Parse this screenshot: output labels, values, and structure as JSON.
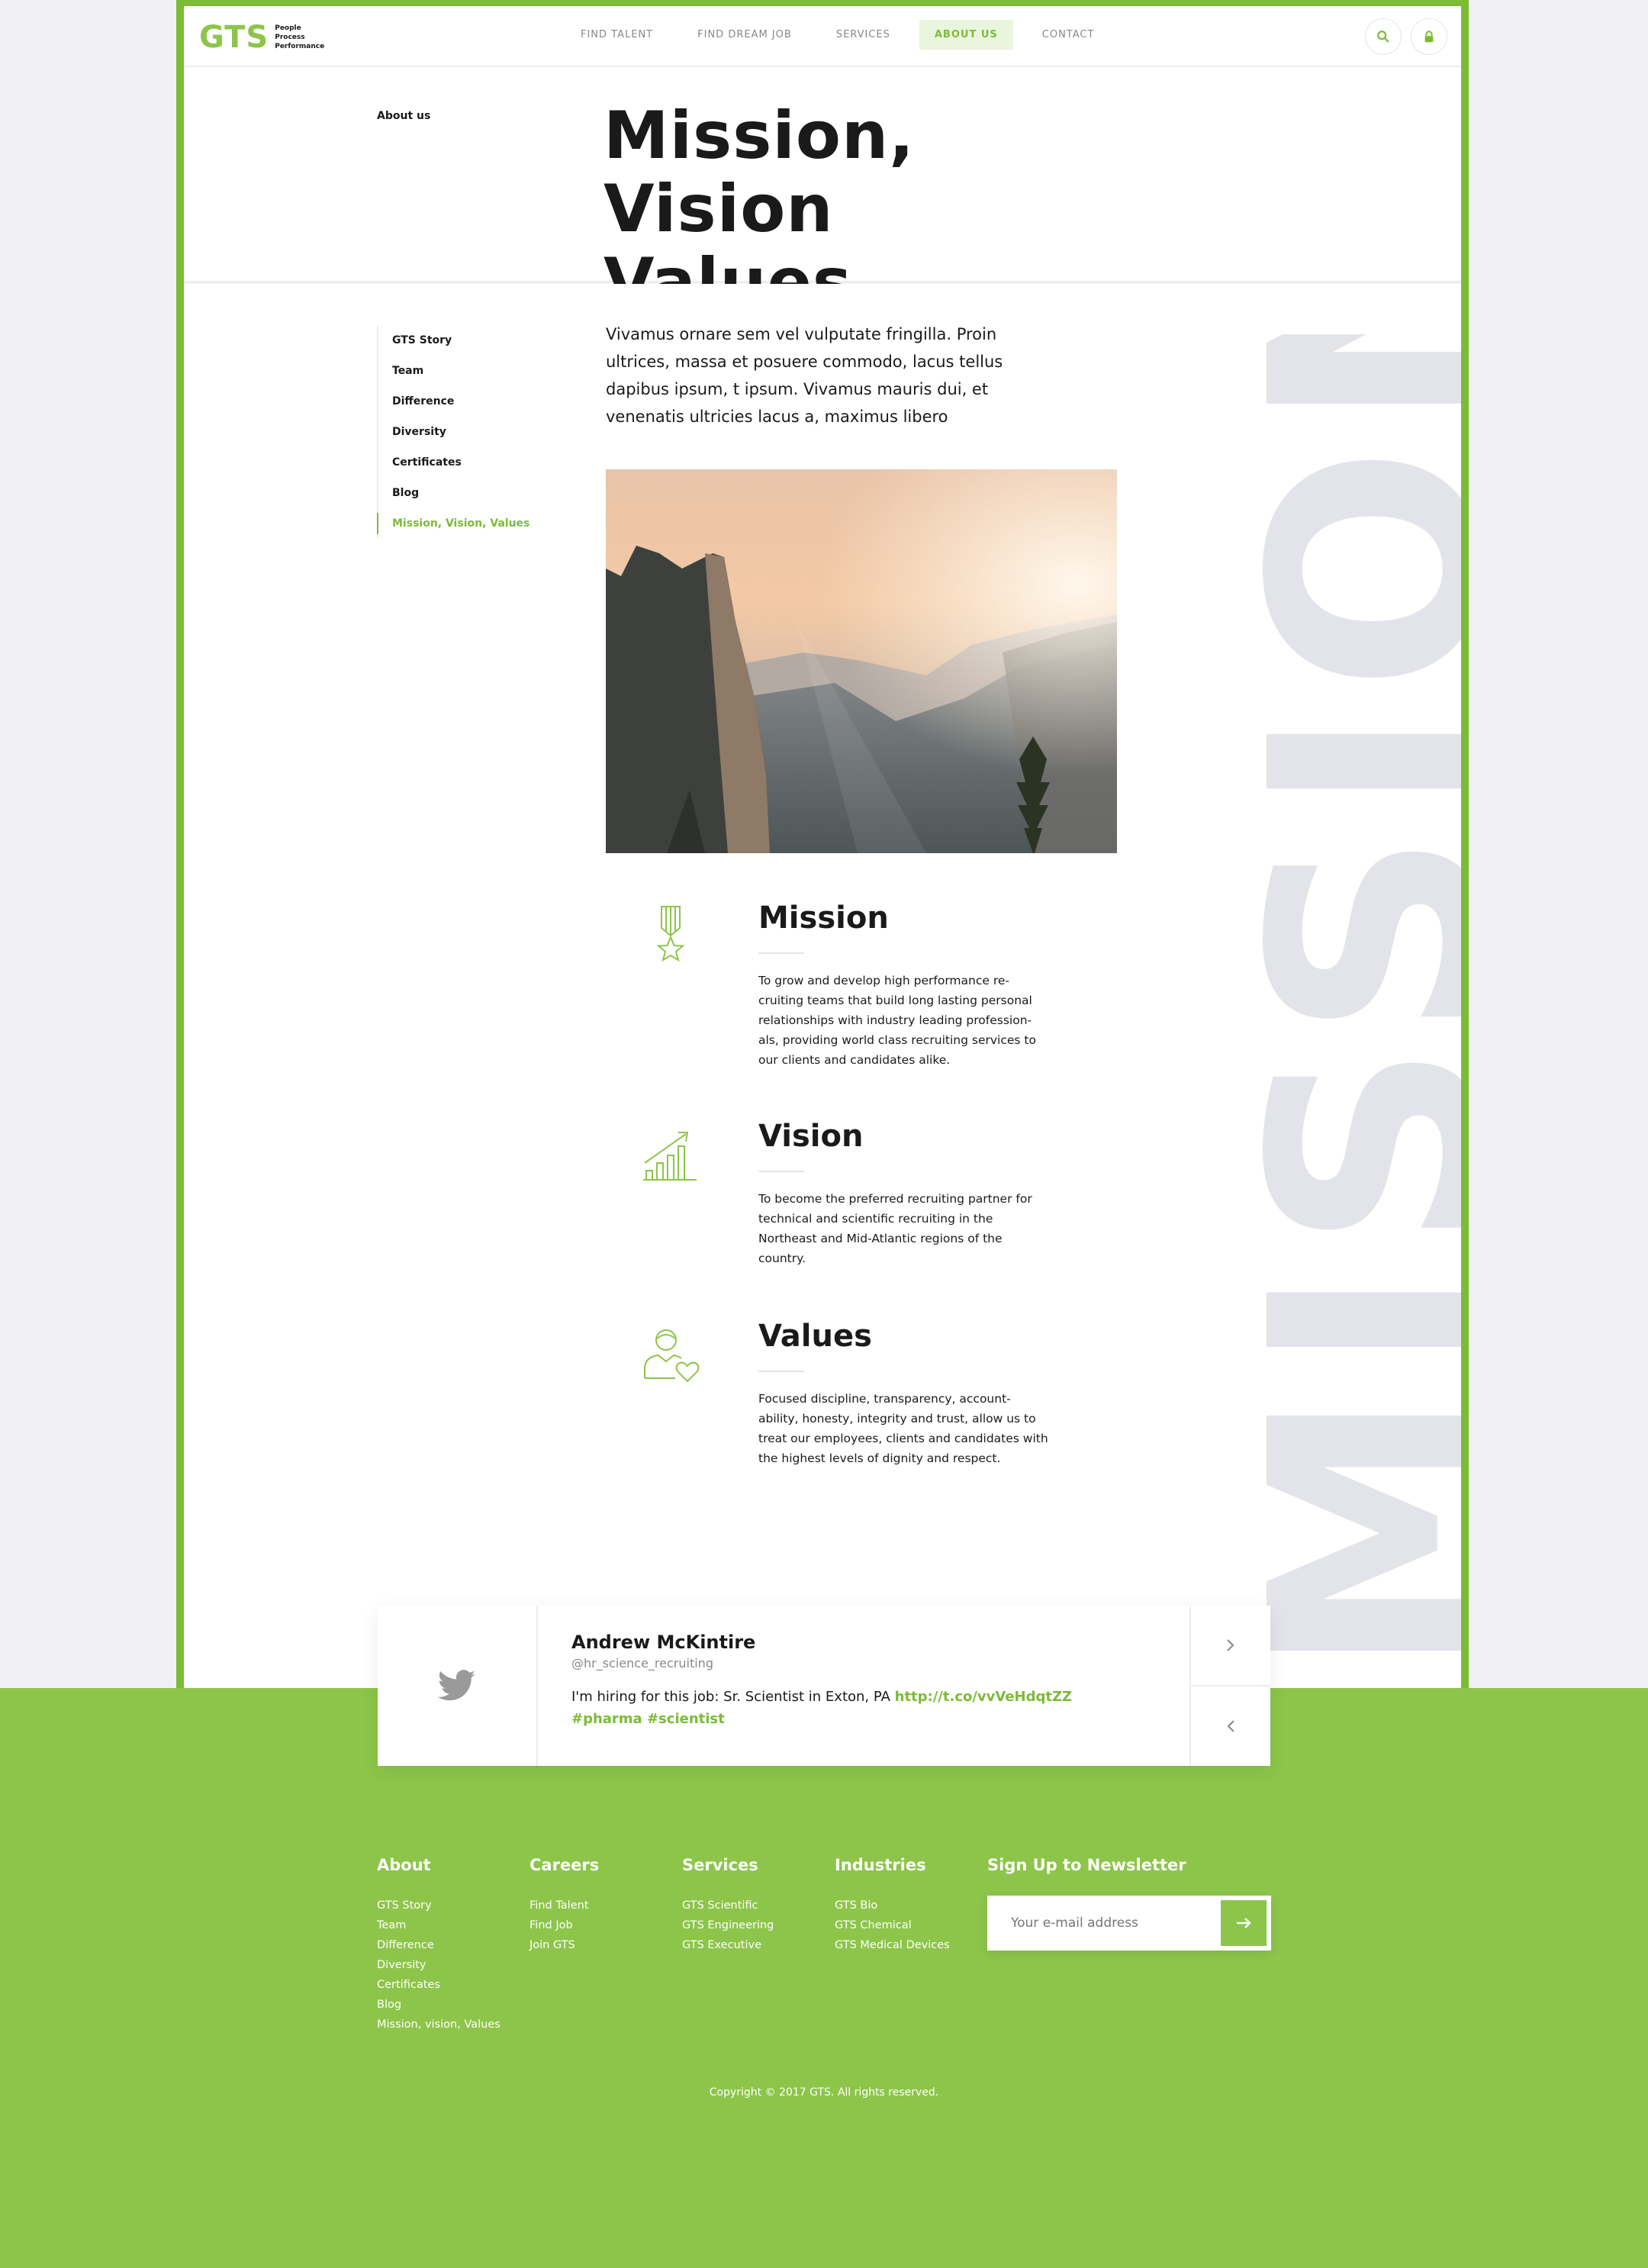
{
  "brand": {
    "logo_text": "GTS",
    "tagline": [
      "People",
      "Process",
      "Performance"
    ],
    "accent": "#8cc54a"
  },
  "nav": {
    "items": [
      {
        "label": "FIND TALENT"
      },
      {
        "label": "FIND DREAM JOB"
      },
      {
        "label": "SERVICES"
      },
      {
        "label": "ABOUT US",
        "active": true
      },
      {
        "label": "CONTACT"
      }
    ],
    "search_icon": "search-icon",
    "lock_icon": "lock-icon"
  },
  "hero": {
    "breadcrumb": "About us",
    "title_line1": "Mission, Vision",
    "title_line2": "Values"
  },
  "watermark": "MISSION",
  "sidemenu": {
    "items": [
      {
        "label": "GTS Story"
      },
      {
        "label": "Team"
      },
      {
        "label": "Difference"
      },
      {
        "label": "Diversity"
      },
      {
        "label": "Certificates"
      },
      {
        "label": "Blog"
      },
      {
        "label": "Mission, Vision, Values",
        "active": true
      }
    ]
  },
  "intro": "Vivamus ornare sem vel vulputate fringilla. Proin ultrices, massa et posuere commodo, lacus tellus dapibus ipsum, t ipsum. Vivamus mauris dui, et venenatis ultricies lacus a, maximus libero",
  "sections": {
    "mission": {
      "title": "Mission",
      "text": "To grow and develop high performance re-cruiting teams that build long lasting personal relationships with industry leading profession-als, providing world class recruiting services to our clients and candidates alike.",
      "icon": "medal-icon"
    },
    "vision": {
      "title": "Vision",
      "text": "To become the preferred recruiting partner for technical and scientific recruiting in the Northeast and Mid-Atlantic regions of the country.",
      "icon": "growth-chart-icon"
    },
    "values": {
      "title": "Values",
      "text": "Focused discipline, transparency, account-ability, honesty, integrity and trust, allow us to treat our employees, clients and candidates with the highest levels of dignity and respect.",
      "icon": "person-heart-icon"
    }
  },
  "tweet": {
    "name": "Andrew McKintire",
    "handle": "@hr_science_recruiting",
    "text": "I'm hiring for this job: Sr. Scientist in Exton, PA",
    "link": "http://t.co/vvVeHdqtZZ",
    "tags": "#pharma #scientist",
    "icon": "twitter-icon"
  },
  "footer": {
    "about": {
      "title": "About",
      "links": [
        "GTS Story",
        "Team",
        "Difference",
        "Diversity",
        "Certificates",
        "Blog",
        "Mission, vision, Values"
      ]
    },
    "careers": {
      "title": "Careers",
      "links": [
        "Find Talent",
        "Find Job",
        "Join GTS"
      ]
    },
    "services": {
      "title": "Services",
      "links": [
        "GTS Scientific",
        "GTS Engineering",
        "GTS Executive"
      ]
    },
    "industries": {
      "title": "Industries",
      "links": [
        "GTS Bio",
        "GTS Chemical",
        "GTS Medical Devices"
      ]
    },
    "newsletter": {
      "title": "Sign Up to Newsletter",
      "placeholder": "Your e-mail address"
    },
    "copyright": "Copyright © 2017 GTS. All rights reserved."
  }
}
